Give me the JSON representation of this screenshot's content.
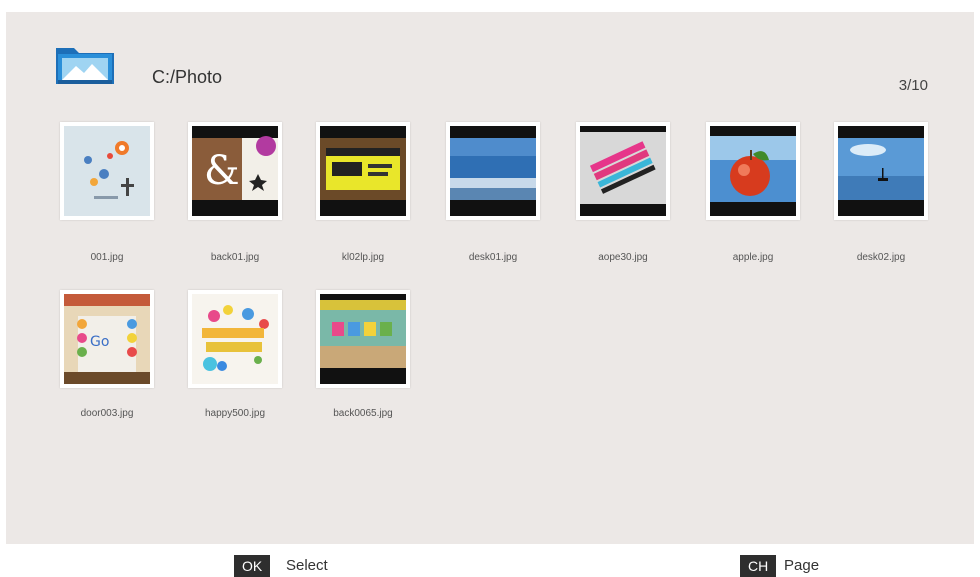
{
  "header": {
    "path": "C:/Photo",
    "page_count": "3/10",
    "folder_icon": "photo-folder-icon"
  },
  "thumbnails": [
    {
      "label": "001.jpg"
    },
    {
      "label": "back01.jpg"
    },
    {
      "label": "kl02lp.jpg"
    },
    {
      "label": "desk01.jpg"
    },
    {
      "label": "aope30.jpg"
    },
    {
      "label": "apple.jpg"
    },
    {
      "label": "desk02.jpg"
    },
    {
      "label": "door003.jpg"
    },
    {
      "label": "happy500.jpg"
    },
    {
      "label": "back0065.jpg"
    }
  ],
  "footer": {
    "ok_key": "OK",
    "ok_action": "Select",
    "ch_key": "CH",
    "ch_action": "Page"
  },
  "colors": {
    "panel_background": "#ece8e6",
    "key_background": "#2e2e2e"
  }
}
